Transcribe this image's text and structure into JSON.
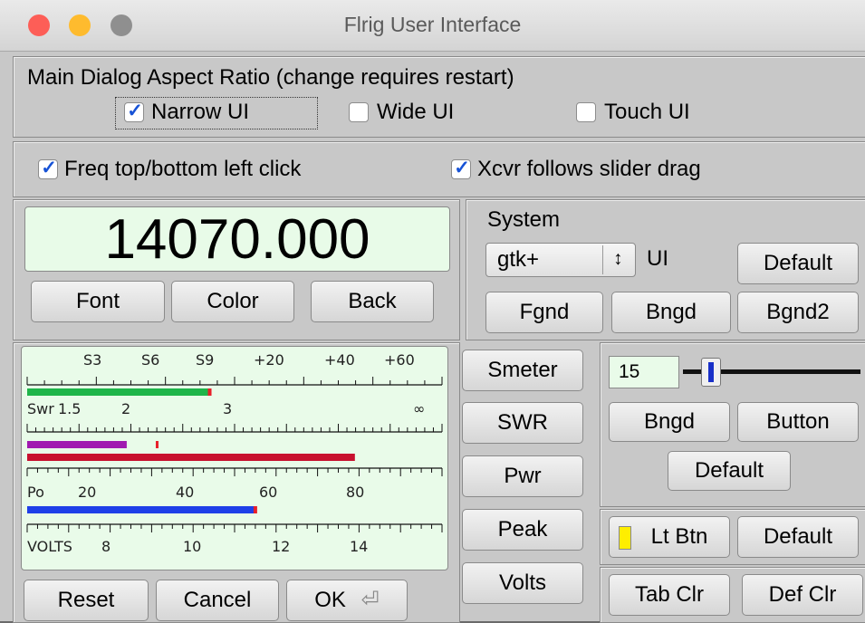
{
  "window": {
    "title": "Flrig User Interface"
  },
  "aspect": {
    "heading": "Main Dialog Aspect Ratio (change requires restart)",
    "options": [
      {
        "label": "Narrow UI",
        "checked": true
      },
      {
        "label": "Wide UI",
        "checked": false
      },
      {
        "label": "Touch UI",
        "checked": false
      }
    ]
  },
  "clicks": {
    "freq_label": "Freq top/bottom left click",
    "freq_checked": true,
    "xcvr_label": "Xcvr follows slider drag",
    "xcvr_checked": true
  },
  "display": {
    "freq": "14070.000",
    "font_btn": "Font",
    "color_btn": "Color",
    "back_btn": "Back"
  },
  "system": {
    "label": "System",
    "theme": "gtk+",
    "spin_glyph": "↕",
    "ui_label": "UI",
    "default_btn": "Default",
    "fgnd_btn": "Fgnd",
    "bngd_btn": "Bngd",
    "bgnd2_btn": "Bgnd2"
  },
  "meters": {
    "s_ticks": [
      "S3",
      "S6",
      "S9",
      "+20",
      "+40",
      "+60"
    ],
    "swr_ticks": [
      "Swr",
      "1.5",
      "2",
      "3",
      "∞"
    ],
    "pwr_ticks": [
      "Po",
      "20",
      "40",
      "60",
      "80"
    ],
    "volt_ticks": [
      "VOLTS",
      "8",
      "10",
      "12",
      "14"
    ],
    "s_level": 0.44,
    "swr_level": 0.24,
    "swr_peak": 0.31,
    "red_level": 0.79,
    "pwr_level": 0.55,
    "colors": {
      "smeter": "#1fb54a",
      "swr": "#a01ab0",
      "peak": "#c8102e",
      "pwr": "#1f3fe8",
      "marker": "#e8202a"
    }
  },
  "meter_buttons": [
    "Smeter",
    "SWR",
    "Pwr",
    "Peak",
    "Volts"
  ],
  "slider": {
    "value": "15",
    "level": 0.12,
    "bngd_btn": "Bngd",
    "button_btn": "Button",
    "default_btn": "Default"
  },
  "lt": {
    "ltbtn": "Lt Btn",
    "default_btn": "Default",
    "indicator_color": "#ffee00"
  },
  "tabs": {
    "tabclr": "Tab Clr",
    "defclr": "Def Clr"
  },
  "footer": {
    "reset": "Reset",
    "cancel": "Cancel",
    "ok": "OK",
    "enter_glyph": "⏎"
  }
}
